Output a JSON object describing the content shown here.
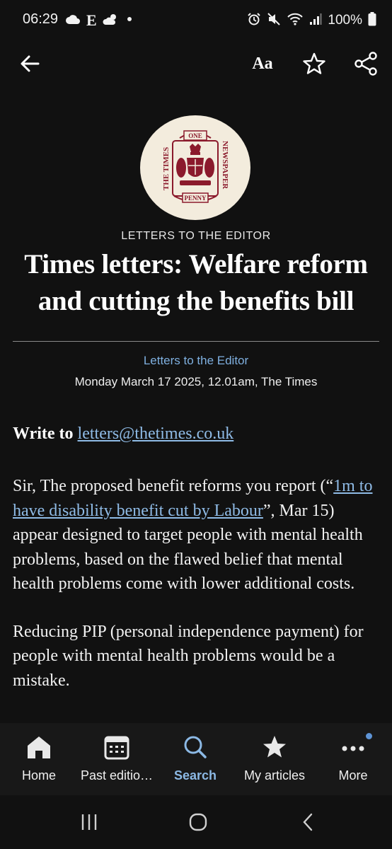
{
  "status_bar": {
    "time": "06:29",
    "battery": "100%",
    "left_icons": [
      "cloud-icon",
      "e-letter",
      "weather-icon",
      "dot-icon"
    ],
    "e_letter": "E",
    "right_icons": [
      "alarm-icon",
      "mute-icon",
      "wifi-icon",
      "signal-icon",
      "battery-icon"
    ]
  },
  "app_bar": {
    "font_size_label": "Aa"
  },
  "article": {
    "section_kicker": "LETTERS TO THE EDITOR",
    "headline": "Times letters: Welfare reform and cutting the benefits bill",
    "byline_section": "Letters to the Editor",
    "byline_date": "Monday March 17 2025, 12.01am, The Times",
    "write_to_prefix": "Write to",
    "write_to_email": "letters@thetimes.co.uk",
    "p1_before": "Sir, The proposed benefit reforms you report (“",
    "p1_link": "1m to have disability benefit cut by Labour",
    "p1_after": "”, Mar 15) appear designed to target people with mental health problems, based on the flawed belief that mental health problems come with lower additional costs.",
    "p2": "Reducing PIP (personal independence payment) for people with mental health problems would be a mistake."
  },
  "bottom_nav": {
    "items": [
      {
        "label": "Home",
        "icon": "home-icon"
      },
      {
        "label": "Past editio…",
        "icon": "calendar-icon"
      },
      {
        "label": "Search",
        "icon": "search-icon",
        "active": true
      },
      {
        "label": "My articles",
        "icon": "star-filled-icon"
      },
      {
        "label": "More",
        "icon": "more-icon"
      }
    ]
  },
  "colors": {
    "background": "#111111",
    "link": "#8fbbe6",
    "active_nav": "#8cb9e5",
    "logo_bg": "#f3ecdd",
    "logo_red": "#8b1a2c"
  }
}
